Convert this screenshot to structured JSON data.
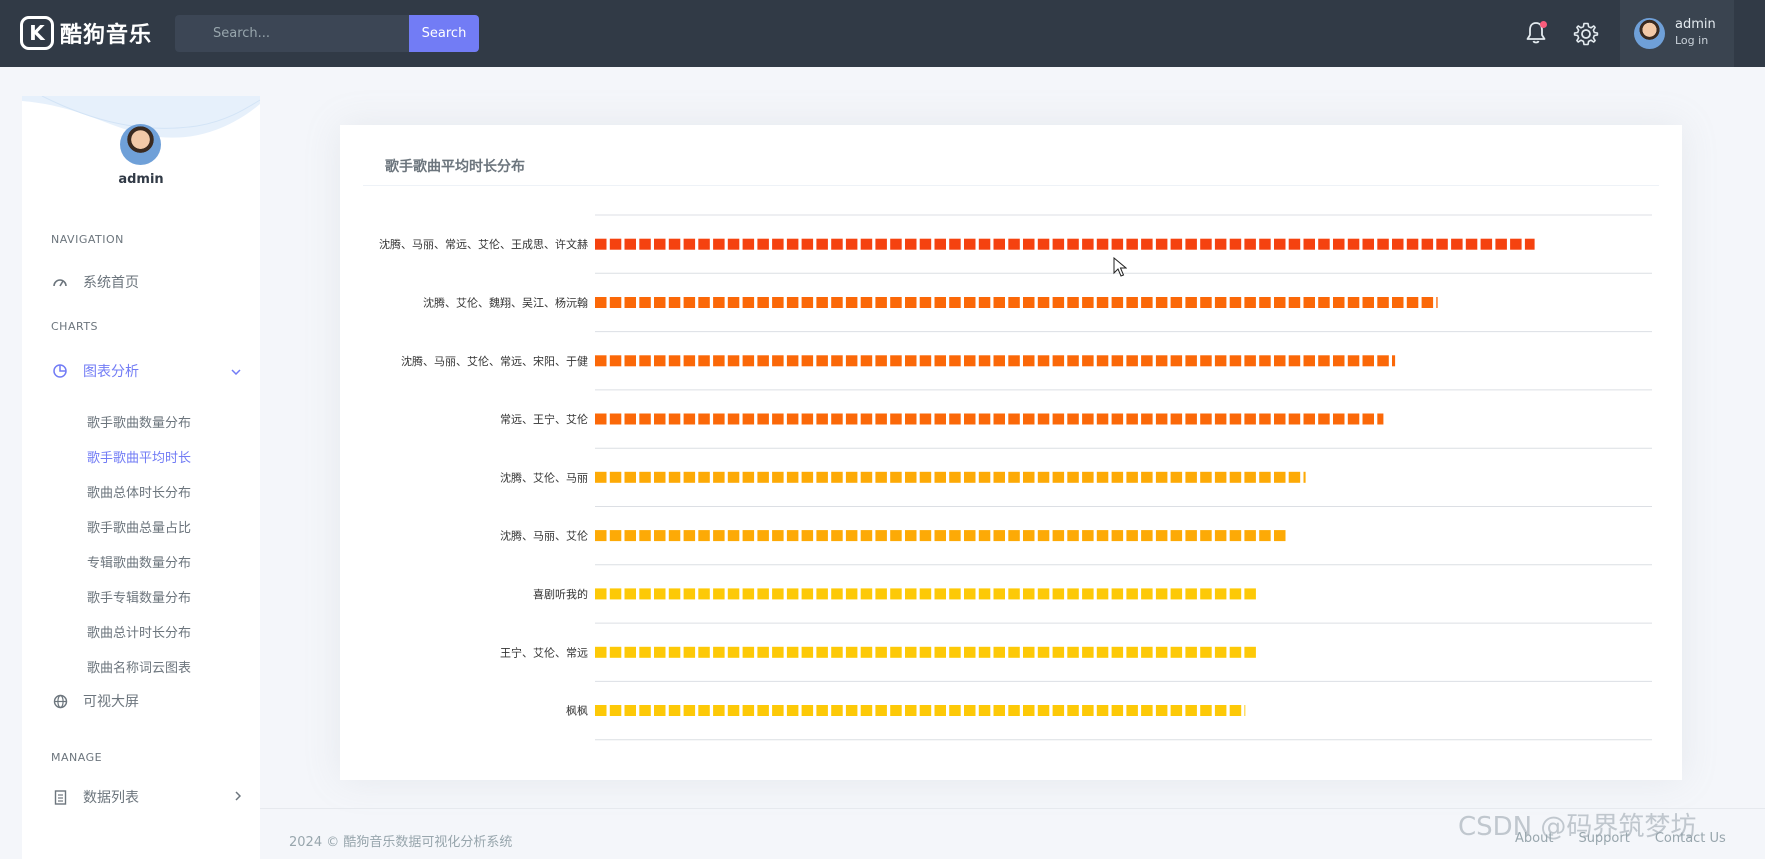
{
  "header": {
    "logo_letter": "K",
    "logo_text": "酷狗音乐",
    "search_placeholder": "Search...",
    "search_button": "Search",
    "user_name": "admin",
    "user_role": "Log in"
  },
  "sidebar": {
    "profile_name": "admin",
    "sections": {
      "navigation": "NAVIGATION",
      "charts": "CHARTS",
      "manage": "MANAGE"
    },
    "items": {
      "home": "系统首页",
      "chart_analysis": "图表分析",
      "big_screen": "可视大屏",
      "data_list": "数据列表"
    },
    "sub_items": [
      "歌手歌曲数量分布",
      "歌手歌曲平均时长",
      "歌曲总体时长分布",
      "歌手歌曲总量占比",
      "专辑歌曲数量分布",
      "歌手专辑数量分布",
      "歌曲总计时长分布",
      "歌曲名称词云图表"
    ],
    "active_sub_index": 1
  },
  "card": {
    "title": "歌手歌曲平均时长分布"
  },
  "chart_data": {
    "type": "bar",
    "orientation": "horizontal",
    "style": "pictorial-blocks",
    "categories": [
      "沈腾、马丽、常远、艾伦、王成思、许文赫",
      "沈腾、艾伦、魏翔、吴江、杨沅翰",
      "沈腾、马丽、艾伦、常远、宋阳、于健",
      "常远、王宁、艾伦",
      "沈腾、艾伦、马丽",
      "沈腾、马丽、艾伦",
      "喜剧听我的",
      "王宁、艾伦、常远",
      "枫枫"
    ],
    "values": [
      320,
      287,
      272.5,
      268.5,
      242,
      236,
      225.5,
      225.5,
      221.5
    ],
    "colors": [
      "#f5420f",
      "#fb6808",
      "#fb6808",
      "#fb6808",
      "#fdaa06",
      "#fdaa06",
      "#fdc907",
      "#fdc907",
      "#fdc907"
    ],
    "xlim": [
      0,
      360
    ]
  },
  "footer": {
    "copyright": "2024 © 酷狗音乐数据可视化分析系统",
    "links": [
      "About",
      "Support",
      "Contact Us"
    ],
    "watermark": "CSDN @码界筑梦坊"
  }
}
